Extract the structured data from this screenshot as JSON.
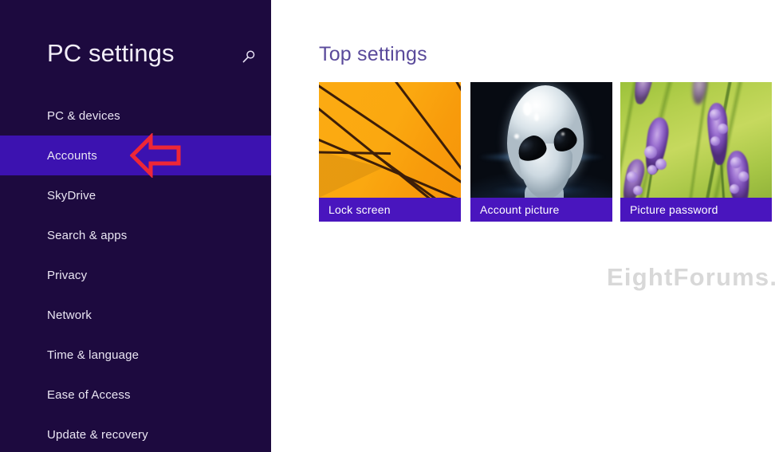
{
  "colors": {
    "sidebar_bg": "#1d0a3f",
    "sidebar_selected_bg": "#3c12b0",
    "main_bg": "#ffffff",
    "heading_purple": "#5a4a9b",
    "tile_caption_bg": "#4915be",
    "annotation_red": "#ee2737",
    "watermark_gray": "#d8d8d8"
  },
  "sidebar": {
    "title": "PC settings",
    "search_icon": "search-icon",
    "items": [
      {
        "label": "PC & devices",
        "selected": false
      },
      {
        "label": "Accounts",
        "selected": true
      },
      {
        "label": "SkyDrive",
        "selected": false
      },
      {
        "label": "Search & apps",
        "selected": false
      },
      {
        "label": "Privacy",
        "selected": false
      },
      {
        "label": "Network",
        "selected": false
      },
      {
        "label": "Time & language",
        "selected": false
      },
      {
        "label": "Ease of Access",
        "selected": false
      },
      {
        "label": "Update & recovery",
        "selected": false
      }
    ]
  },
  "annotation": {
    "type": "arrow-left-outline",
    "color": "#ee2737",
    "points_at": "Accounts"
  },
  "main": {
    "heading": "Top settings",
    "tiles": [
      {
        "caption": "Lock screen",
        "art": "orange-umbrella-photo"
      },
      {
        "caption": "Account picture",
        "art": "alien-head-photo"
      },
      {
        "caption": "Picture password",
        "art": "lavender-flowers-photo"
      }
    ]
  },
  "watermark": {
    "text": "EightForums.com"
  }
}
